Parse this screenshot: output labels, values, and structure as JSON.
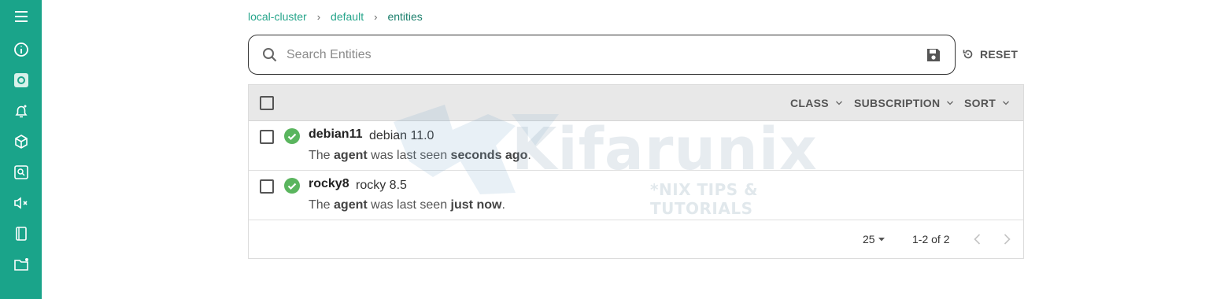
{
  "sidebar": {
    "items": [
      {
        "icon": "menu-icon"
      },
      {
        "icon": "info-icon"
      },
      {
        "icon": "dashboard-icon"
      },
      {
        "icon": "bell-icon"
      },
      {
        "icon": "entities-cube-icon"
      },
      {
        "icon": "checks-icon"
      },
      {
        "icon": "silence-icon"
      },
      {
        "icon": "events-icon"
      },
      {
        "icon": "folder-icon"
      }
    ],
    "color": "#1aa48a"
  },
  "breadcrumb": {
    "items": [
      "local-cluster",
      "default",
      "entities"
    ],
    "separator": "›"
  },
  "search": {
    "placeholder": "Search Entities",
    "value": ""
  },
  "reset_label": "RESET",
  "table": {
    "filters": {
      "class": "CLASS",
      "subscription": "SUBSCRIPTION",
      "sort": "SORT"
    },
    "rows": [
      {
        "name": "debian11",
        "os": "debian 11.0",
        "desc_pre": "The",
        "desc_agent": "agent",
        "desc_mid": "was last seen",
        "desc_time": "seconds ago",
        "desc_end": ".",
        "status": "ok"
      },
      {
        "name": "rocky8",
        "os": "rocky 8.5",
        "desc_pre": "The",
        "desc_agent": "agent",
        "desc_mid": "was last seen",
        "desc_time": "just now",
        "desc_end": ".",
        "status": "ok"
      }
    ],
    "pagination": {
      "per_page": "25",
      "range": "1-2 of 2"
    }
  },
  "watermark": {
    "text": "Kifarunix",
    "subtitle": "*NIX TIPS & TUTORIALS"
  },
  "colors": {
    "accent": "#26a58b",
    "status_ok": "#5ab55e"
  }
}
